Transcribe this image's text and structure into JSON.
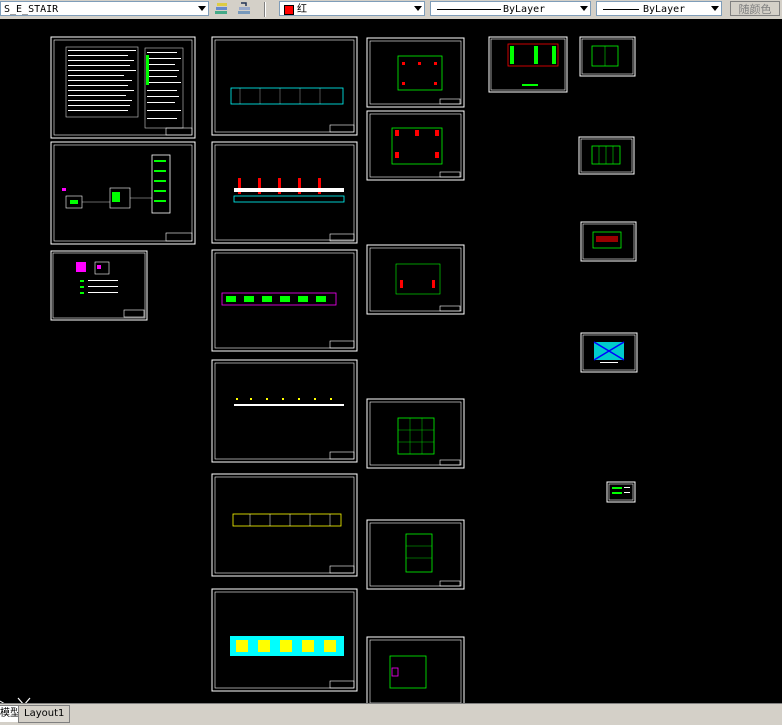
{
  "toolbar": {
    "layer_value": "S_E_STAIR",
    "color_value": "红",
    "linetype_value": "ByLayer",
    "lineweight_value": "ByLayer",
    "plot_style_value": "随颜色",
    "colors": {
      "toolbar_bg": "#d4d0c8",
      "swatch": "#ff0000"
    }
  },
  "canvas": {
    "background": "#000000"
  },
  "tabs": {
    "model": "模型",
    "layout1": "Layout1"
  },
  "icons": [
    "layer-manager-icon",
    "layer-previous-icon",
    "ucs-icon"
  ]
}
